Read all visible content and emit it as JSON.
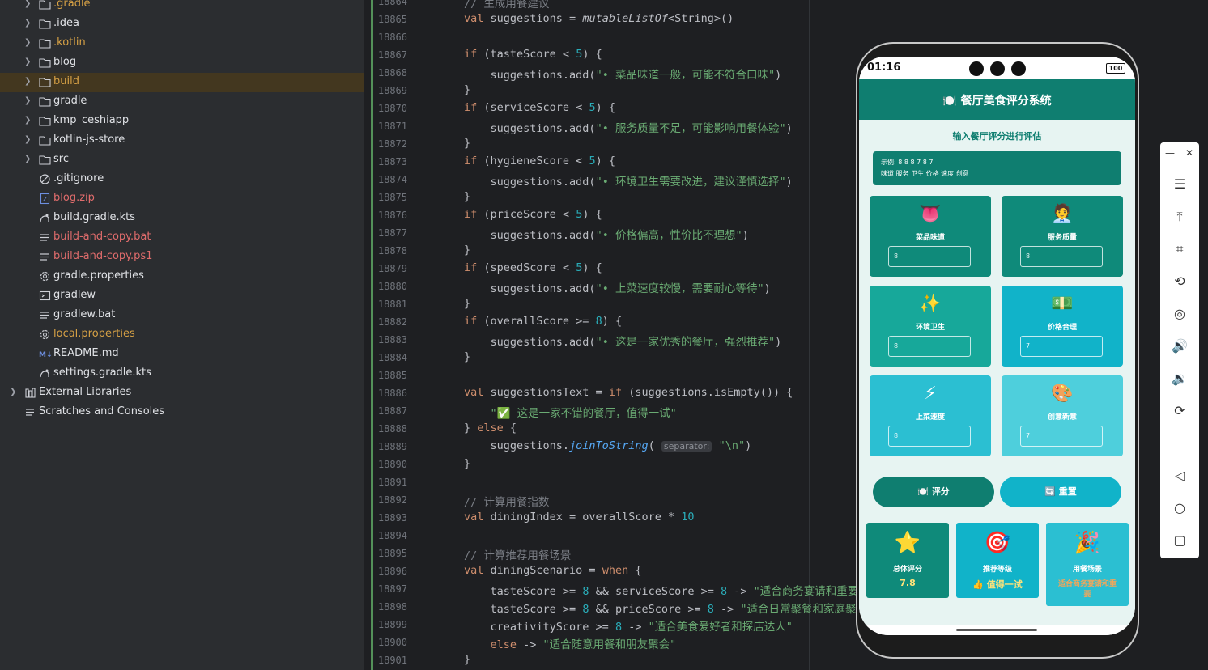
{
  "project_tree": {
    "items": [
      {
        "label": ".gradle",
        "kind": "folder",
        "color": "orange",
        "expandable": true
      },
      {
        "label": ".idea",
        "kind": "folder",
        "color": "default",
        "expandable": true
      },
      {
        "label": ".kotlin",
        "kind": "folder",
        "color": "orange",
        "expandable": true
      },
      {
        "label": "blog",
        "kind": "folder",
        "color": "default",
        "expandable": true
      },
      {
        "label": "build",
        "kind": "folder",
        "color": "orange",
        "expandable": true
      },
      {
        "label": "gradle",
        "kind": "folder",
        "color": "default",
        "expandable": true
      },
      {
        "label": "kmp_ceshiapp",
        "kind": "folder",
        "color": "default",
        "expandable": true
      },
      {
        "label": "kotlin-js-store",
        "kind": "folder",
        "color": "default",
        "expandable": true
      },
      {
        "label": "src",
        "kind": "folder",
        "color": "default",
        "expandable": true
      },
      {
        "label": ".gitignore",
        "kind": "ignore-file",
        "color": "default",
        "expandable": false
      },
      {
        "label": "blog.zip",
        "kind": "zip-file",
        "color": "red",
        "expandable": false
      },
      {
        "label": "build.gradle.kts",
        "kind": "gradle-file",
        "color": "default",
        "expandable": false
      },
      {
        "label": "build-and-copy.bat",
        "kind": "text-file",
        "color": "red",
        "expandable": false
      },
      {
        "label": "build-and-copy.ps1",
        "kind": "text-file",
        "color": "red",
        "expandable": false
      },
      {
        "label": "gradle.properties",
        "kind": "settings-file",
        "color": "default",
        "expandable": false
      },
      {
        "label": "gradlew",
        "kind": "terminal-file",
        "color": "default",
        "expandable": false
      },
      {
        "label": "gradlew.bat",
        "kind": "text-file",
        "color": "default",
        "expandable": false
      },
      {
        "label": "local.properties",
        "kind": "settings-file",
        "color": "orange",
        "expandable": false
      },
      {
        "label": "README.md",
        "kind": "markdown-file",
        "color": "default",
        "expandable": false
      },
      {
        "label": "settings.gradle.kts",
        "kind": "gradle-file",
        "color": "default",
        "expandable": false
      },
      {
        "label": "External Libraries",
        "kind": "library",
        "color": "default",
        "expandable": true
      },
      {
        "label": "Scratches and Consoles",
        "kind": "scratches",
        "color": "default",
        "expandable": false
      }
    ],
    "selected": "build"
  },
  "editor": {
    "lines": [
      {
        "n": "18864",
        "html": "<span class=\"cm\">// 生成用餐建议</span>"
      },
      {
        "n": "18865",
        "html": "<span class=\"kw\">val</span> suggestions = <span class=\"it\">mutableListOf</span>&lt;String&gt;()"
      },
      {
        "n": "18866",
        "html": ""
      },
      {
        "n": "18867",
        "html": "<span class=\"kw\">if</span> (tasteScore &lt; <span class=\"num\">5</span>) {"
      },
      {
        "n": "18868",
        "html": "    suggestions.add(<span class=\"str\">\"• 菜品味道一般，可能不符合口味\"</span>)"
      },
      {
        "n": "18869",
        "html": "}"
      },
      {
        "n": "18870",
        "html": "<span class=\"kw\">if</span> (serviceScore &lt; <span class=\"num\">5</span>) {"
      },
      {
        "n": "18871",
        "html": "    suggestions.add(<span class=\"str\">\"• 服务质量不足，可能影响用餐体验\"</span>)"
      },
      {
        "n": "18872",
        "html": "}"
      },
      {
        "n": "18873",
        "html": "<span class=\"kw\">if</span> (hygieneScore &lt; <span class=\"num\">5</span>) {"
      },
      {
        "n": "18874",
        "html": "    suggestions.add(<span class=\"str\">\"• 环境卫生需要改进，建议谨慎选择\"</span>)"
      },
      {
        "n": "18875",
        "html": "}"
      },
      {
        "n": "18876",
        "html": "<span class=\"kw\">if</span> (priceScore &lt; <span class=\"num\">5</span>) {"
      },
      {
        "n": "18877",
        "html": "    suggestions.add(<span class=\"str\">\"• 价格偏高，性价比不理想\"</span>)"
      },
      {
        "n": "18878",
        "html": "}"
      },
      {
        "n": "18879",
        "html": "<span class=\"kw\">if</span> (speedScore &lt; <span class=\"num\">5</span>) {"
      },
      {
        "n": "18880",
        "html": "    suggestions.add(<span class=\"str\">\"• 上菜速度较慢，需要耐心等待\"</span>)"
      },
      {
        "n": "18881",
        "html": "}"
      },
      {
        "n": "18882",
        "html": "<span class=\"kw\">if</span> (overallScore &gt;= <span class=\"num\">8</span>) {"
      },
      {
        "n": "18883",
        "html": "    suggestions.add(<span class=\"str\">\"• 这是一家优秀的餐厅，强烈推荐\"</span>)"
      },
      {
        "n": "18884",
        "html": "}"
      },
      {
        "n": "18885",
        "html": ""
      },
      {
        "n": "18886",
        "html": "<span class=\"kw\">val</span> suggestionsText = <span class=\"kw\">if</span> (suggestions.isEmpty()) {"
      },
      {
        "n": "18887",
        "html": "    <span class=\"str\">\"✅ 这是一家不错的餐厅，值得一试\"</span>"
      },
      {
        "n": "18888",
        "html": "} <span class=\"kw\">else</span> {"
      },
      {
        "n": "18889",
        "html": "    suggestions.<span class=\"fn\">joinToString</span>( <span class=\"hint\">separator:</span> <span class=\"str\">\"\\n\"</span>)"
      },
      {
        "n": "18890",
        "html": "}"
      },
      {
        "n": "18891",
        "html": ""
      },
      {
        "n": "18892",
        "html": "<span class=\"cm\">// 计算用餐指数</span>"
      },
      {
        "n": "18893",
        "html": "<span class=\"kw\">val</span> diningIndex = overallScore * <span class=\"num\">10</span>"
      },
      {
        "n": "18894",
        "html": ""
      },
      {
        "n": "18895",
        "html": "<span class=\"cm\">// 计算推荐用餐场景</span>"
      },
      {
        "n": "18896",
        "html": "<span class=\"kw\">val</span> diningScenario = <span class=\"kw\">when</span> {"
      },
      {
        "n": "18897",
        "html": "    tasteScore &gt;= <span class=\"num\">8</span> &amp;&amp; serviceScore &gt;= <span class=\"num\">8</span> -&gt; <span class=\"str\">\"适合商务宴请和重要聚会\"</span>"
      },
      {
        "n": "18898",
        "html": "    tasteScore &gt;= <span class=\"num\">8</span> &amp;&amp; priceScore &gt;= <span class=\"num\">8</span> -&gt; <span class=\"str\">\"适合日常聚餐和家庭聚会\"</span>"
      },
      {
        "n": "18899",
        "html": "    creativityScore &gt;= <span class=\"num\">8</span> -&gt; <span class=\"str\">\"适合美食爱好者和探店达人\"</span>"
      },
      {
        "n": "18900",
        "html": "    <span class=\"kw\">else</span> -&gt; <span class=\"str\">\"适合随意用餐和朋友聚会\"</span>"
      },
      {
        "n": "18901",
        "html": "}"
      }
    ]
  },
  "phone": {
    "time": "01:16",
    "battery": "100",
    "app_title": "🍽️ 餐厅美食评分系统",
    "subtitle": "输入餐厅评分进行评估",
    "example_line1": "示例: 8 8 8 7 8 7",
    "example_line2": "味道 服务 卫生 价格 速度 创意",
    "cards": [
      {
        "emoji": "👅",
        "label": "菜品味道",
        "value": "8",
        "color": "#0f8a7a"
      },
      {
        "emoji": "🧑‍💼",
        "label": "服务质量",
        "value": "8",
        "color": "#0f8a7a"
      },
      {
        "emoji": "✨",
        "label": "环境卫生",
        "value": "8",
        "color": "#17a89a"
      },
      {
        "emoji": "💵",
        "label": "价格合理",
        "value": "7",
        "color": "#11b3c9"
      },
      {
        "emoji": "⚡",
        "label": "上菜速度",
        "value": "8",
        "color": "#2bbfd2"
      },
      {
        "emoji": "🎨",
        "label": "创意新意",
        "value": "7",
        "color": "#4ecfdc"
      }
    ],
    "evaluate_button": "🍽️ 评分",
    "reset_button": "🔄 重置",
    "results": [
      {
        "emoji": "⭐",
        "label": "总体评分",
        "value": "7.8",
        "value_color": "#ffe27a",
        "color": "#0f8a7a"
      },
      {
        "emoji": "🎯",
        "label": "推荐等级",
        "value": "👍 值得一试",
        "value_color": "#ffe27a",
        "color": "#11b3c9"
      },
      {
        "emoji": "🎉",
        "label": "用餐场景",
        "value": "适合商务宴请和重要",
        "value_color": "#f2a65a",
        "color": "#2bbfd2"
      }
    ]
  },
  "side_toolbar": {
    "icons": [
      "minimize-icon",
      "close-icon",
      "menu-icon",
      "pin-top-icon",
      "crop-icon",
      "rotate-icon",
      "screenshot-icon",
      "volume-up-icon",
      "volume-down-icon",
      "rotate-device-icon",
      "back-icon",
      "home-icon",
      "recents-icon"
    ]
  }
}
